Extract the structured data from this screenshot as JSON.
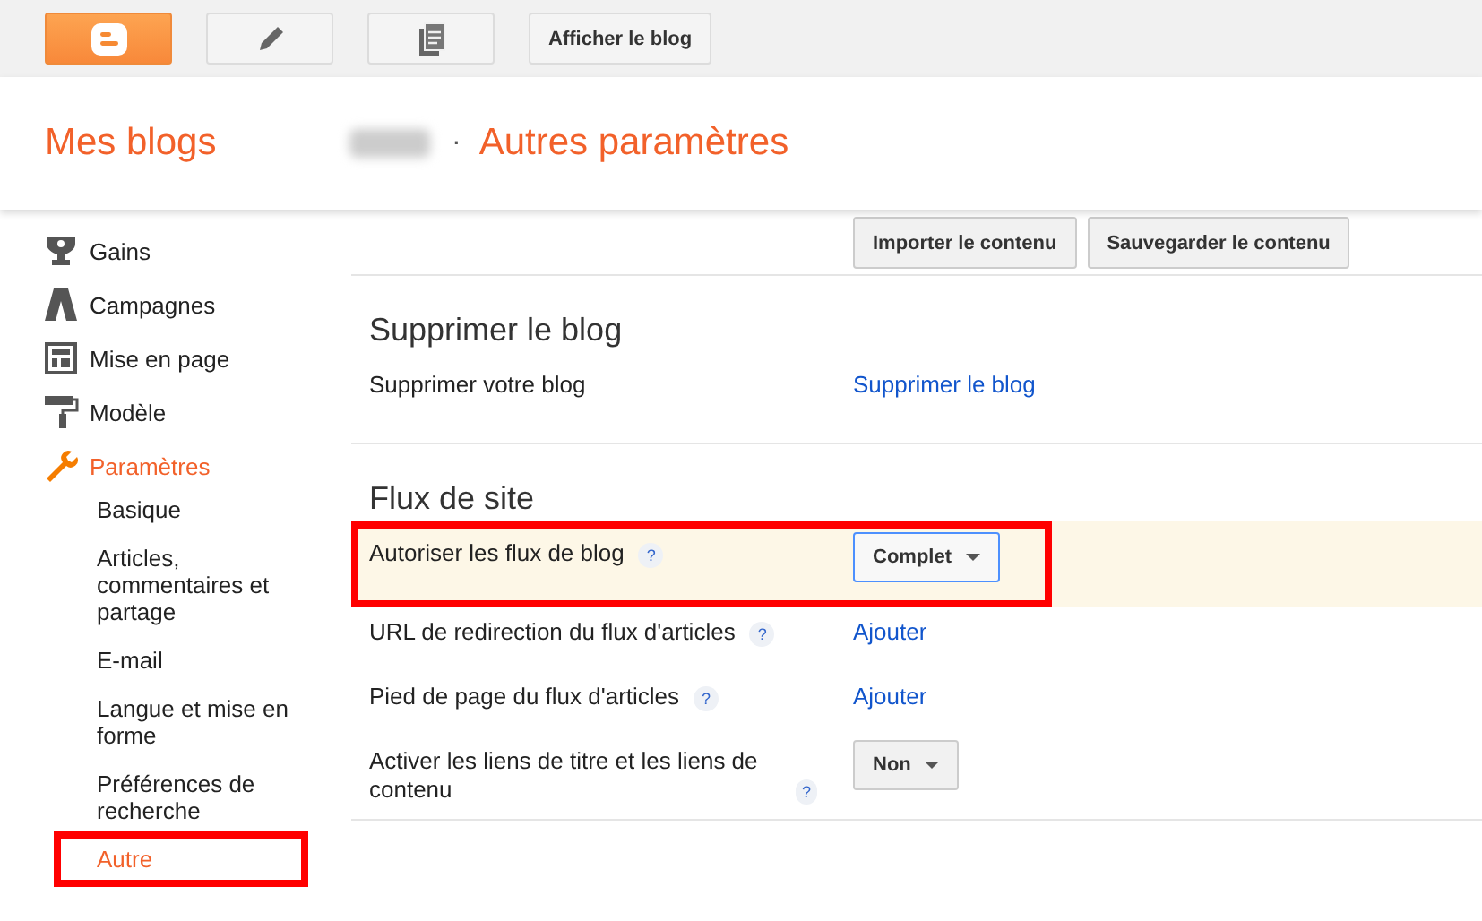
{
  "toolbar": {
    "buttons": [
      {
        "kind": "logo"
      },
      {
        "kind": "pencil"
      },
      {
        "kind": "pages"
      },
      {
        "kind": "text",
        "label": "Afficher le blog"
      }
    ]
  },
  "header": {
    "title": "Mes blogs",
    "separator": "·",
    "page_title": "Autres paramètres"
  },
  "sidebar": {
    "items": [
      {
        "kind": "trophy",
        "label": "Gains",
        "selected": false
      },
      {
        "kind": "campaign",
        "label": "Campagnes",
        "selected": false
      },
      {
        "kind": "layout",
        "label": "Mise en page",
        "selected": false
      },
      {
        "kind": "roller",
        "label": "Modèle",
        "selected": false
      },
      {
        "kind": "wrench",
        "label": "Paramètres",
        "selected": true,
        "children": [
          {
            "label": "Basique",
            "selected": false,
            "highlighted": false
          },
          {
            "label": "Articles, commentaires et partage",
            "selected": false,
            "highlighted": false
          },
          {
            "label": "E-mail",
            "selected": false,
            "highlighted": false
          },
          {
            "label": "Langue et mise en forme",
            "selected": false,
            "highlighted": false
          },
          {
            "label": "Préférences de recherche",
            "selected": false,
            "highlighted": false
          },
          {
            "label": "Autre",
            "selected": true,
            "highlighted": true
          }
        ]
      }
    ]
  },
  "cut_section": {
    "buttons": [
      "Importer le contenu",
      "Sauvegarder le contenu"
    ]
  },
  "sections": [
    {
      "title": "Supprimer le blog",
      "rows": [
        {
          "label": "Supprimer votre blog",
          "help": false,
          "kind": "link",
          "value": "Supprimer le blog",
          "highlighted": false
        }
      ]
    },
    {
      "title": "Flux de site",
      "rows": [
        {
          "label": "Autoriser les flux de blog",
          "help": true,
          "help_mark": "?",
          "kind": "dropdown",
          "value": "Complet",
          "highlighted": true
        },
        {
          "label": "URL de redirection du flux d'articles",
          "help": true,
          "help_mark": "?",
          "kind": "link",
          "value": "Ajouter",
          "highlighted": false
        },
        {
          "label": "Pied de page du flux d'articles",
          "help": true,
          "help_mark": "?",
          "kind": "link",
          "value": "Ajouter",
          "highlighted": false
        },
        {
          "label": "Activer les liens de titre et les liens de contenu",
          "help": true,
          "help_mark": "?",
          "kind": "dropdown",
          "value": "Non",
          "highlighted": false
        }
      ]
    }
  ]
}
